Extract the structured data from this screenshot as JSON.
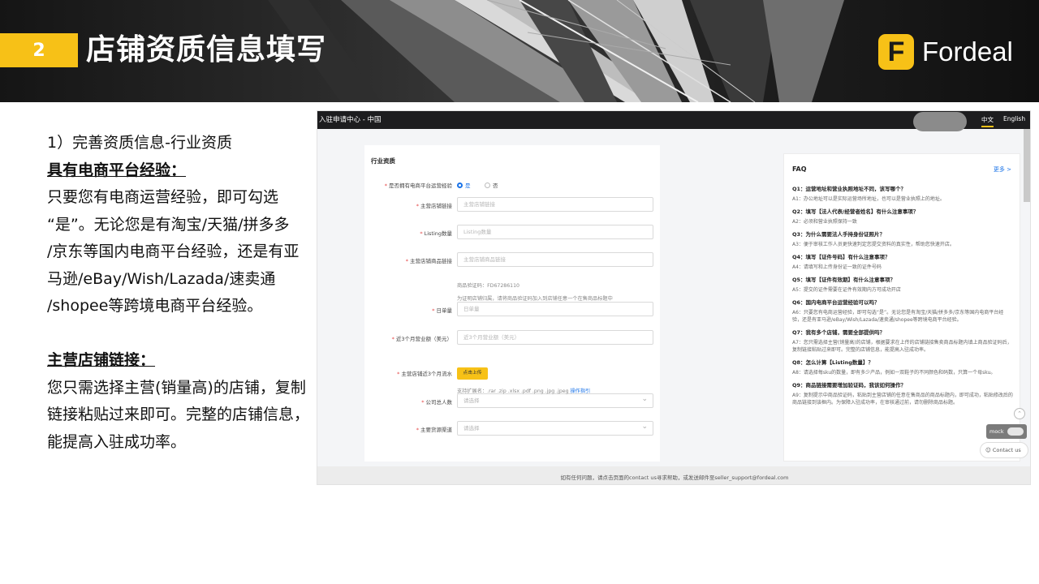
{
  "header": {
    "section_number": "2",
    "section_title": "店铺资质信息填写",
    "brand_mark": "F",
    "brand_name": "Fordeal"
  },
  "left_text": {
    "lines": [
      {
        "text": "1）完善资质信息-行业资质",
        "style": "normal"
      },
      {
        "text": "具有电商平台经验：",
        "style": "head"
      },
      {
        "text": "只要您有电商运营经验，即可勾选",
        "style": "normal"
      },
      {
        "text": "“是”。无论您是有淘宝/天猫/拼多多",
        "style": "normal"
      },
      {
        "text": "/京东等国内电商平台经验，还是有亚",
        "style": "normal"
      },
      {
        "text": "马逊/eBay/Wish/Lazada/速卖通",
        "style": "normal"
      },
      {
        "text": "/shopee等跨境电商平台经验。",
        "style": "normal"
      },
      {
        "text": "",
        "style": "gap"
      },
      {
        "text": "主营店铺链接：",
        "style": "head"
      },
      {
        "text": "您只需选择主营(销量高)的店铺，复制",
        "style": "normal"
      },
      {
        "text": "链接粘贴过来即可。完整的店铺信息，",
        "style": "normal"
      },
      {
        "text": "能提高入驻成功率。",
        "style": "normal"
      }
    ]
  },
  "screenshot": {
    "topbar_title": "入驻申请中心 - 中国",
    "lang_cn": "中文",
    "lang_en": "English",
    "form": {
      "heading": "行业资质",
      "experience_label": "是否拥有电商平台运营经验",
      "radio_yes": "是",
      "radio_no": "否",
      "fields": [
        {
          "label": "主营店铺链接",
          "placeholder": "主营店铺链接",
          "kind": "input"
        },
        {
          "label": "Listing数量",
          "placeholder": "Listing数量",
          "kind": "input"
        },
        {
          "label": "主营店铺商品链接",
          "placeholder": "主营店铺商品链接",
          "kind": "input"
        },
        {
          "label": "日单量",
          "placeholder": "日单量",
          "kind": "input"
        },
        {
          "label": "近3个月营业额（美元）",
          "placeholder": "近3个月营业额（美元）",
          "kind": "input"
        },
        {
          "label": "公司总人数",
          "placeholder": "请选择",
          "kind": "select"
        },
        {
          "label": "主要货源渠道",
          "placeholder": "请选择",
          "kind": "select"
        }
      ],
      "verify_code": "商品验证码：FD67286110",
      "verify_hint": "为证明店铺归属，请将商品验证码加入到店铺任意一个在售商品标题中",
      "sales_label": "主营店铺近3个月流水",
      "upload_button": "点击上传",
      "upload_hint": "支持扩展名：.rar .zip .xlsx .pdf .png .jpg .jpeg",
      "upload_guide": "操作指引"
    },
    "faq": {
      "title": "FAQ",
      "more": "更多 >",
      "items": [
        {
          "q": "Q1：运营地址和营业执照地址不同，该写哪个？",
          "a": "A1：办公地址可以是实际运营场所地址，也可以是营业执照上的地址。"
        },
        {
          "q": "Q2：填写【法人代表/经营者姓名】有什么注意事项？",
          "a": "A2：必须和营业执照保持一致"
        },
        {
          "q": "Q3：为什么需要法人手持身份证照片？",
          "a": "A3：便于审核工作人员更快速判定您提交资料的真实性，帮助您快速开店。"
        },
        {
          "q": "Q4：填写【证件号码】有什么注意事项？",
          "a": "A4：请填写和上传身份证一致的证件号码"
        },
        {
          "q": "Q5：填写【证件有效期】有什么注意事项？",
          "a": "A5：提交的证件需要在证件有效期内方可成功开店"
        },
        {
          "q": "Q6：国内电商平台运营经验可以吗？",
          "a": "A6：只要您有电商运营经验，即可勾选“是”。无论您是有淘宝/天猫/拼多多/京东等国内电商平台经验，还是有亚马逊/eBay/Wish/Lazada/速卖通/shopee等跨境电商平台经验。"
        },
        {
          "q": "Q7：我有多个店铺，需要全部提供吗？",
          "a": "A7：您只需选择主营(销量高)的店铺，根据要求在上传的店铺链接售卖商品标题内填上商品验证码后，复制链接粘贴过来即可。完整的店铺信息，能提高入驻成功率。"
        },
        {
          "q": "Q8：怎么计算【Listing数量】？",
          "a": "A8：请选择每sku的数量，即有多少产品，例如一双鞋子的不同颜色和码数，只算一个母sku。"
        },
        {
          "q": "Q9：商品链接需要增加验证码，我该如何操作？",
          "a": "A9：复制提示中商品验证码，粘贴到主营店铺的任意在售商品的商品标题内，即可成功，粘贴修改后的商品链接到该框内。为保障入驻成功率，在审核通过前，请勿删除商品标题。"
        }
      ]
    },
    "mock_label": "mock",
    "contact_label": "Contact us",
    "footer": "如有任何问题，请点击页面的contact us寻求帮助，或发送邮件至seller_support@fordeal.com"
  }
}
